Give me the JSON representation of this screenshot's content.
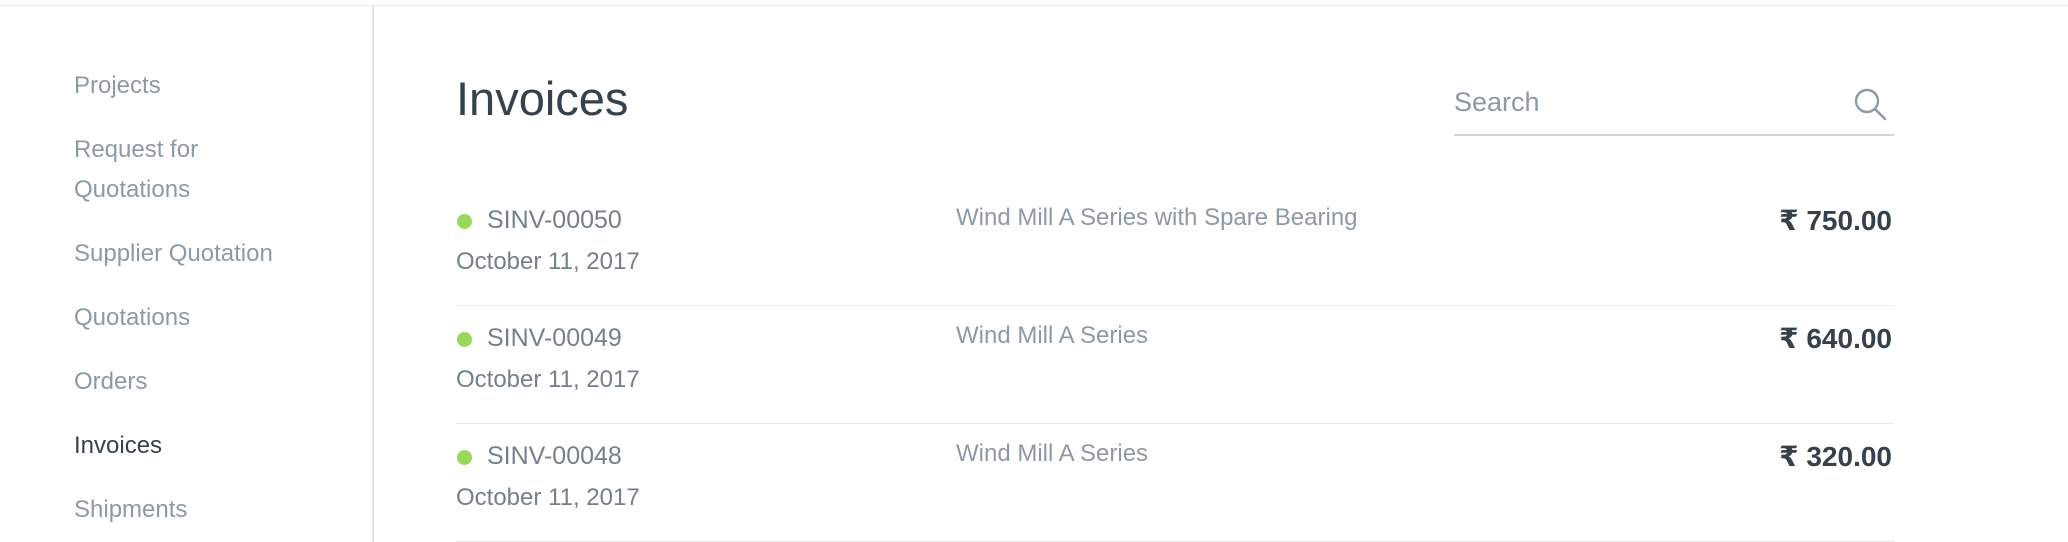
{
  "sidebar": {
    "items": [
      {
        "label": "Projects"
      },
      {
        "label": "Request for"
      },
      {
        "label": "Quotations"
      },
      {
        "label": "Supplier Quotation"
      },
      {
        "label": "Quotations"
      },
      {
        "label": "Orders"
      },
      {
        "label": "Invoices",
        "active": true
      },
      {
        "label": "Shipments"
      }
    ]
  },
  "page": {
    "title": "Invoices"
  },
  "search": {
    "placeholder": "Search",
    "value": "",
    "icon": "search-icon"
  },
  "invoices": [
    {
      "name": "SINV-00050",
      "date": "October 11, 2017",
      "description": "Wind Mill A Series with Spare Bearing",
      "amount": "₹ 750.00",
      "status_color": "#98d85b"
    },
    {
      "name": "SINV-00049",
      "date": "October 11, 2017",
      "description": "Wind Mill A Series",
      "amount": "₹ 640.00",
      "status_color": "#98d85b"
    },
    {
      "name": "SINV-00048",
      "date": "October 11, 2017",
      "description": "Wind Mill A Series",
      "amount": "₹ 320.00",
      "status_color": "#98d85b"
    }
  ],
  "colors": {
    "text_primary": "#36414c",
    "text_muted": "#8d99a6",
    "status_paid": "#98d85b",
    "border": "#e3e6ea"
  }
}
